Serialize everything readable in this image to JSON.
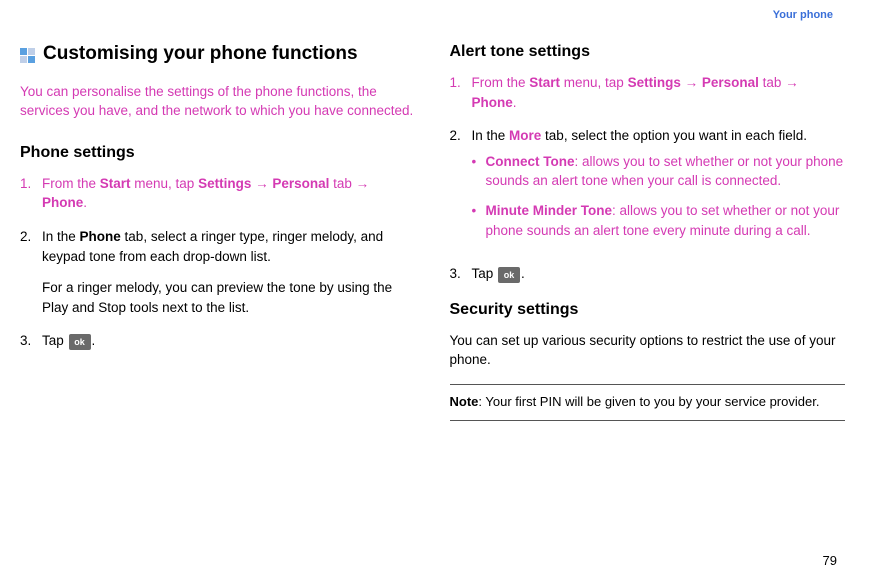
{
  "header": {
    "section_link": "Your phone"
  },
  "page_number": "79",
  "left": {
    "main_heading": "Customising your phone functions",
    "intro": "You can personalise the settings of the phone functions, the services you have, and the network to which you have connected.",
    "phone_settings_heading": "Phone settings",
    "step1_num": "1.",
    "step1_prefix": "From the ",
    "step1_start": "Start",
    "step1_mid1": " menu, tap ",
    "step1_settings": "Settings",
    "step1_arrow1": " → ",
    "step1_personal": "Personal",
    "step1_mid2": " tab → ",
    "step1_phone": "Phone",
    "step1_end": ".",
    "step2_num": "2.",
    "step2_prefix": "In the ",
    "step2_phone_tab": "Phone",
    "step2_rest": " tab, select a ringer type, ringer melody, and keypad tone from each drop-down list.",
    "step2_extra": "For a ringer melody, you can preview the tone by using the Play and Stop tools next to the list.",
    "step3_num": "3.",
    "step3_prefix": "Tap ",
    "step3_end": ".",
    "ok_label": "ok"
  },
  "right": {
    "alert_heading": "Alert tone settings",
    "step1_num": "1.",
    "step1_prefix": "From the ",
    "step1_start": "Start",
    "step1_mid1": " menu, tap ",
    "step1_settings": "Settings",
    "step1_arrow1": " → ",
    "step1_personal": "Personal",
    "step1_mid2": " tab → ",
    "step1_phone": "Phone",
    "step1_end": ".",
    "step2_num": "2.",
    "step2_prefix": "In the ",
    "step2_more": "More",
    "step2_rest": " tab, select the option you want in each field.",
    "bullet1_label": "Connect Tone",
    "bullet1_rest": ": allows you to set whether or not your phone sounds an alert tone when your call is connected.",
    "bullet2_label": "Minute Minder Tone",
    "bullet2_rest": ": allows you to set whether or not your phone sounds an alert tone every minute during a call.",
    "step3_num": "3.",
    "step3_prefix": "Tap ",
    "step3_end": ".",
    "ok_label": "ok",
    "security_heading": "Security settings",
    "security_text": "You can set up various security options to restrict the use of your phone.",
    "note_label": "Note",
    "note_text": ": Your first PIN will be given to you by your service provider."
  }
}
